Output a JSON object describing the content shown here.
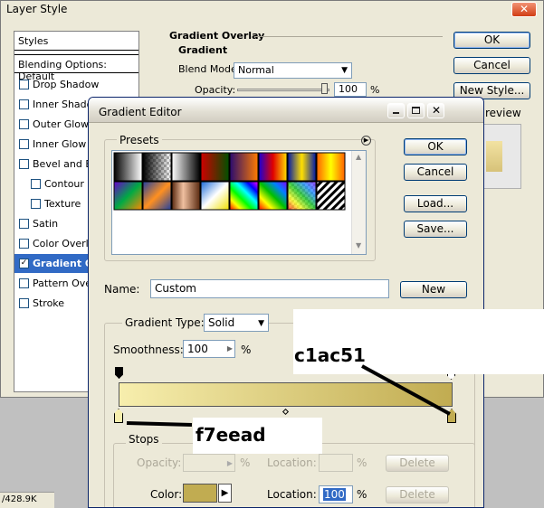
{
  "layer_style": {
    "title": "Layer Style",
    "styles_header": "Styles",
    "blending": "Blending Options: Default",
    "items": [
      {
        "label": "Drop Shadow",
        "checked": false
      },
      {
        "label": "Inner Shadow",
        "checked": false
      },
      {
        "label": "Outer Glow",
        "checked": false
      },
      {
        "label": "Inner Glow",
        "checked": false
      },
      {
        "label": "Bevel and Emboss",
        "checked": false
      },
      {
        "label": "Contour",
        "checked": false
      },
      {
        "label": "Texture",
        "checked": false
      },
      {
        "label": "Satin",
        "checked": false
      },
      {
        "label": "Color Overlay",
        "checked": false
      },
      {
        "label": "Gradient Overlay",
        "checked": true
      },
      {
        "label": "Pattern Overlay",
        "checked": false
      },
      {
        "label": "Stroke",
        "checked": false
      }
    ],
    "section_title": "Gradient Overlay",
    "subsection": "Gradient",
    "blend_mode_label": "Blend Mode:",
    "blend_mode": "Normal",
    "opacity_label": "Opacity:",
    "opacity_value": "100",
    "percent": "%",
    "ok": "OK",
    "cancel": "Cancel",
    "new_style": "New Style...",
    "preview": "review",
    "status": "/428.9K"
  },
  "gradient_editor": {
    "title": "Gradient Editor",
    "presets_label": "Presets",
    "ok": "OK",
    "cancel": "Cancel",
    "load": "Load...",
    "save": "Save...",
    "name_label": "Name:",
    "name_value": "Custom",
    "new": "New",
    "gradient_type_label": "Gradient Type:",
    "gradient_type": "Solid",
    "smoothness_label": "Smoothness:",
    "smoothness_value": "100",
    "percent": "%",
    "stops_label": "Stops",
    "opacity_label": "Opacity:",
    "location_label": "Location:",
    "delete": "Delete",
    "color_label": "Color:",
    "color_location": "100",
    "color_swatch": "#c1ac51",
    "gradient_start": "#f7eead",
    "gradient_end": "#c1ac51"
  },
  "annotations": {
    "right": "c1ac51",
    "left": "f7eead"
  }
}
